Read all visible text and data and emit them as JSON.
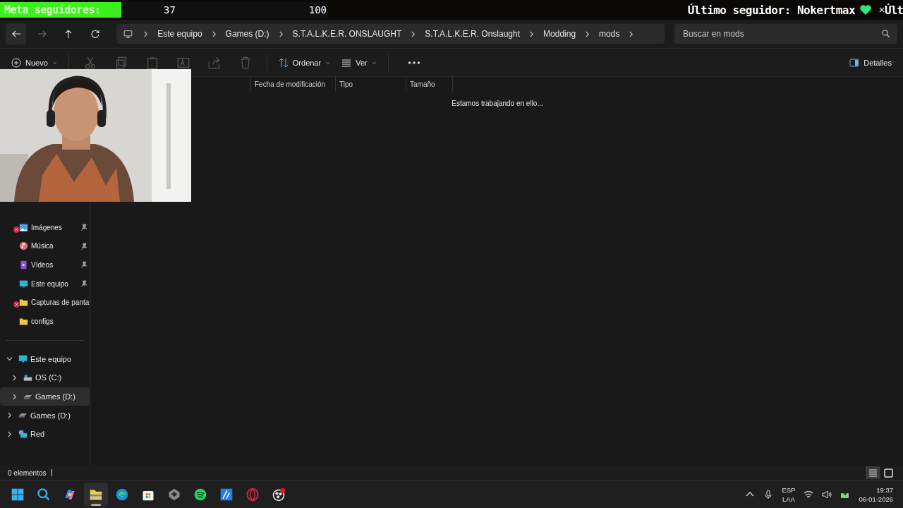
{
  "stream_overlay": {
    "goal": {
      "label": "Meta seguidores:",
      "current": "37",
      "target": "100",
      "level": 0.37
    },
    "latest_follower": "Último seguidor: Nokertmax",
    "ticker_repeat": "Últ"
  },
  "navigation": {
    "breadcrumbs": [
      "Este equipo",
      "Games (D:)",
      "S.T.A.L.K.E.R. ONSLAUGHT",
      "S.T.A.L.K.E.R. Onslaught",
      "Modding",
      "mods"
    ],
    "search": {
      "placeholder": "Buscar en mods"
    }
  },
  "toolbar": {
    "new_label": "Nuevo",
    "sort_label": "Ordenar",
    "view_label": "Ver",
    "details_label": "Detalles"
  },
  "sidebar": {
    "quick_access": [
      {
        "label": "Imágenes",
        "kind": "pictures",
        "pinned": true,
        "error": true
      },
      {
        "label": "Música",
        "kind": "music",
        "pinned": true,
        "error": false
      },
      {
        "label": "Vídeos",
        "kind": "videos",
        "pinned": true,
        "error": false
      },
      {
        "label": "Este equipo",
        "kind": "computer",
        "pinned": true,
        "error": false
      },
      {
        "label": "Capturas de panta",
        "kind": "folder",
        "pinned": false,
        "error": true
      },
      {
        "label": "configs",
        "kind": "folder",
        "pinned": false,
        "error": false
      }
    ],
    "tree": [
      {
        "label": "Este equipo",
        "kind": "computer",
        "expanded": true,
        "selected": false,
        "children": [
          {
            "label": "OS (C:)",
            "kind": "os-drive",
            "expanded": false,
            "selected": false
          },
          {
            "label": "Games (D:)",
            "kind": "drive",
            "expanded": false,
            "selected": true
          }
        ]
      },
      {
        "label": "Games (D:)",
        "kind": "drive",
        "expanded": false,
        "selected": false
      },
      {
        "label": "Red",
        "kind": "network",
        "expanded": false,
        "selected": false
      }
    ]
  },
  "file_list": {
    "columns": [
      "Fecha de modificación",
      "Tipo",
      "Tamaño"
    ],
    "message": "Estamos trabajando en ello..."
  },
  "status_bar": {
    "count": "0 elementos"
  },
  "taskbar": {
    "apps": [
      {
        "kind": "start",
        "active": false
      },
      {
        "kind": "search",
        "active": false
      },
      {
        "kind": "copilot",
        "active": false
      },
      {
        "kind": "explorer",
        "active": true
      },
      {
        "kind": "edge",
        "active": false
      },
      {
        "kind": "store",
        "active": false
      },
      {
        "kind": "cube",
        "active": false
      },
      {
        "kind": "spotify",
        "active": false
      },
      {
        "kind": "editor",
        "active": false
      },
      {
        "kind": "opera",
        "active": false
      },
      {
        "kind": "obs",
        "active": false
      }
    ],
    "language": "ESP",
    "layout": "LAA",
    "time": "19:37",
    "date": "06-01-2026"
  }
}
